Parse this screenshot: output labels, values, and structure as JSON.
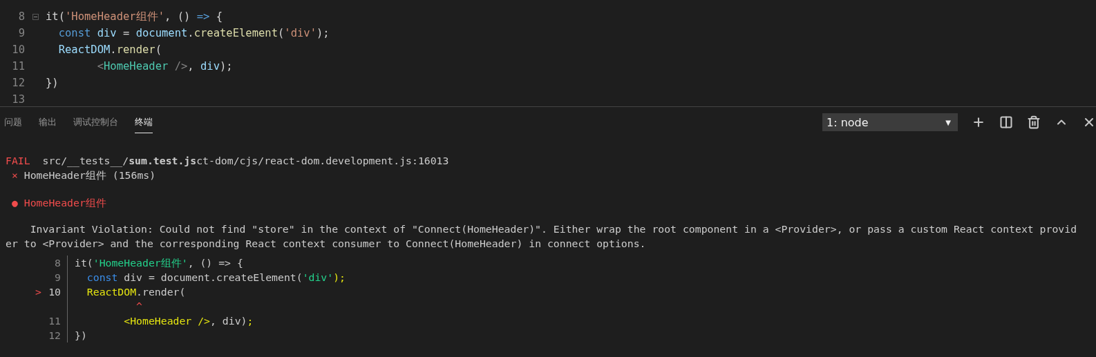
{
  "editor": {
    "lines": [
      {
        "number": "8",
        "expanded": true,
        "tokens": [
          {
            "text": "it(",
            "kind": "plain"
          },
          {
            "text": "'HomeHeader组件'",
            "kind": "string"
          },
          {
            "text": ", () ",
            "kind": "plain"
          },
          {
            "text": "=>",
            "kind": "keyword"
          },
          {
            "text": " {",
            "kind": "plain"
          }
        ]
      },
      {
        "number": "9",
        "tokens": [
          {
            "text": "  const",
            "kind": "keyword"
          },
          {
            "text": " div",
            "kind": "var"
          },
          {
            "text": " = ",
            "kind": "plain"
          },
          {
            "text": "document",
            "kind": "var"
          },
          {
            "text": ".",
            "kind": "plain"
          },
          {
            "text": "createElement",
            "kind": "func"
          },
          {
            "text": "(",
            "kind": "plain"
          },
          {
            "text": "'div'",
            "kind": "string"
          },
          {
            "text": ");",
            "kind": "plain"
          }
        ]
      },
      {
        "number": "10",
        "tokens": [
          {
            "text": "  ReactDOM",
            "kind": "var"
          },
          {
            "text": ".",
            "kind": "plain"
          },
          {
            "text": "render",
            "kind": "func"
          },
          {
            "text": "(",
            "kind": "plain"
          }
        ]
      },
      {
        "number": "11",
        "tokens": [
          {
            "text": "        <",
            "kind": "punct"
          },
          {
            "text": "HomeHeader",
            "kind": "tag"
          },
          {
            "text": " />",
            "kind": "punct"
          },
          {
            "text": ", ",
            "kind": "plain"
          },
          {
            "text": "div",
            "kind": "var"
          },
          {
            "text": ");",
            "kind": "plain"
          }
        ]
      },
      {
        "number": "12",
        "tokens": [
          {
            "text": "})",
            "kind": "plain"
          }
        ]
      },
      {
        "number": "13"
      }
    ]
  },
  "panel": {
    "tabs": [
      {
        "label": "问题",
        "selected": false
      },
      {
        "label": "输出",
        "selected": false
      },
      {
        "label": "调试控制台",
        "selected": false
      },
      {
        "label": "终端",
        "selected": true
      }
    ],
    "terminal_select": {
      "value": "1: node",
      "caret": "▼"
    },
    "terminal": {
      "fail": {
        "badge": "FAIL",
        "path": "src/__tests__/**sum.test.js**ct-dom/cjs/react-dom.development.js:16013"
      },
      "test": {
        "mark": "×",
        "name": "HomeHeader组件 (156ms)"
      },
      "error_title": {
        "mark": "●",
        "name": "HomeHeader组件"
      },
      "message": "Invariant Violation: Could not find \"store\" in the context of \"Connect(HomeHeader)\". Either wrap the root component in a <Provider>, or pass a custom React context provider to <Provider> and the corresponding React context consumer to Connect(HomeHeader) in connect options.",
      "frame": [
        {
          "kind": "code",
          "current": false,
          "number": "8",
          "tokens": [
            {
              "text": "it(",
              "kind": "plain"
            },
            {
              "text": "'HomeHeader组件'",
              "kind": "string"
            },
            {
              "text": ", () => {",
              "kind": "plain"
            }
          ]
        },
        {
          "kind": "code",
          "current": false,
          "number": "9",
          "tokens": [
            {
              "text": "  const",
              "kind": "keyword"
            },
            {
              "text": " div = document.createElement(",
              "kind": "plain"
            },
            {
              "text": "'div'",
              "kind": "string"
            },
            {
              "text": ");",
              "kind": "highlight"
            }
          ]
        },
        {
          "kind": "code",
          "current": true,
          "marker": ">",
          "number": "10",
          "tokens": [
            {
              "text": "  ReactDOM",
              "kind": "highlight"
            },
            {
              "text": ".render(",
              "kind": "plain"
            }
          ]
        },
        {
          "kind": "caret",
          "text": "          ^"
        },
        {
          "kind": "code",
          "current": false,
          "number": "11",
          "tokens": [
            {
              "text": "        <HomeHeader />",
              "kind": "highlight"
            },
            {
              "text": ", div)",
              "kind": "plain"
            },
            {
              "text": ";",
              "kind": "highlight"
            }
          ]
        },
        {
          "kind": "code",
          "current": false,
          "number": "12",
          "tokens": [
            {
              "text": "})",
              "kind": "plain"
            }
          ]
        }
      ]
    }
  }
}
